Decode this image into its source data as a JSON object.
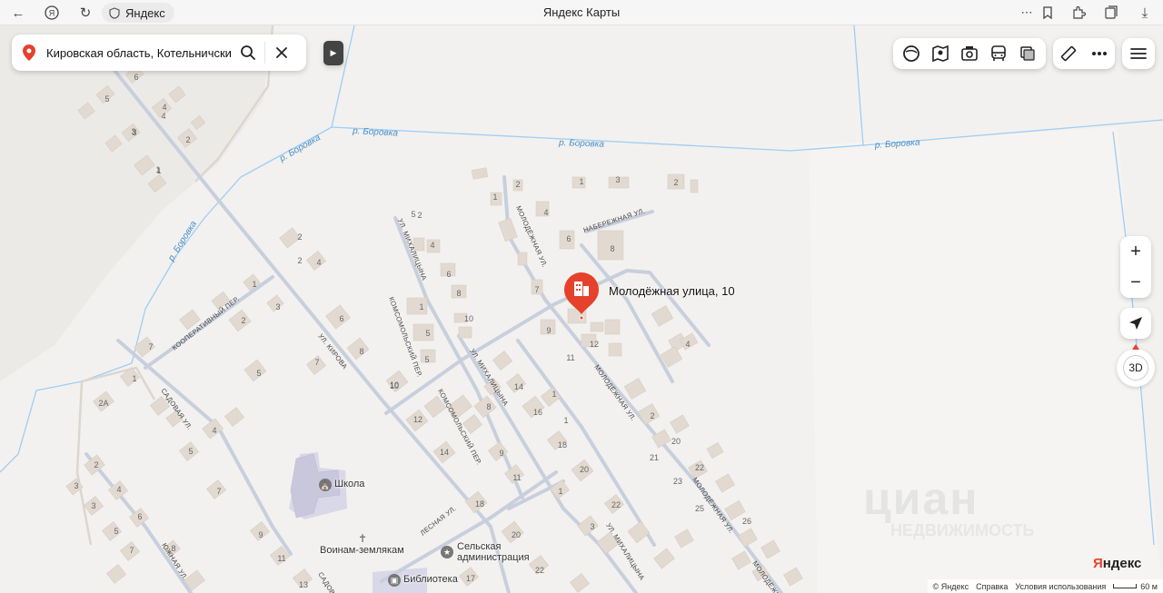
{
  "browser": {
    "site_name": "Яндекс",
    "page_title": "Яндекс Карты"
  },
  "search": {
    "value": "Кировская область, Котельничский р"
  },
  "place": {
    "label": "Молодёжная улица, 10"
  },
  "map_labels": {
    "rivers": [
      "р. Боровка",
      "р. Боровка",
      "р. Боровка",
      "р. Боровка",
      "р. Боровка"
    ],
    "streets": {
      "naberezhnaya": "НАБЕРЕЖНАЯ УЛ.",
      "molodezhnaya_1": "МОЛОДЁЖНАЯ УЛ.",
      "molodezhnaya_2": "МОЛОДЁЖНАЯ УЛ.",
      "molodezhnaya_3": "МОЛОДЁЖНАЯ УЛ.",
      "molodezhnaya_4": "МОЛОДЁЖНАЯ",
      "mikhalitsyna_1": "УЛ. МИХАЛИЦЫНА",
      "mikhalitsyna_2": "УЛ. МИХАЛИЦЫНА",
      "mikhalitsyna_3": "УЛ. МИХАЛИЦЫНА",
      "komsomolsky_1": "КОМСОМОЛЬСКИЙ ПЕР.",
      "komsomolsky_2": "КОМСОМОЛЬСКИЙ ПЕР.",
      "kooperativny": "КООПЕРАТИВНЫЙ ПЕР.",
      "kirova": "УЛ. КИРОВА",
      "sadovaya_1": "САДОВАЯ УЛ.",
      "sadovaya_2": "САДОВ",
      "lesnaya": "ЛЕСНАЯ УЛ.",
      "yuzhnaya": "ЮЖНАЯ УЛ."
    },
    "pois": {
      "school": "Школа",
      "memorial": "Воинам-землякам",
      "administration_1": "Сельская",
      "administration_2": "администрация",
      "library": "Библиотека"
    }
  },
  "house_numbers": [
    "6",
    "5",
    "4",
    "3",
    "2",
    "1",
    "2",
    "1",
    "4",
    "3",
    "2",
    "1",
    "4",
    "5",
    "6",
    "8",
    "2",
    "4",
    "6",
    "8",
    "7",
    "9",
    "10",
    "1",
    "3",
    "5",
    "8",
    "12",
    "14",
    "16",
    "18",
    "20",
    "22",
    "11",
    "10",
    "12",
    "14",
    "9",
    "11",
    "18",
    "20",
    "1",
    "3",
    "5",
    "17",
    "22",
    "21",
    "20",
    "23",
    "25",
    "26",
    "2A",
    "1",
    "7",
    "2",
    "1",
    "3",
    "7",
    "2",
    "4",
    "5",
    "6",
    "7",
    "3",
    "4",
    "5",
    "1",
    "5",
    "6",
    "8",
    "9",
    "11",
    "13",
    "10",
    "7",
    "8",
    "4",
    "2",
    "1",
    "1",
    "2",
    "4",
    "2",
    "3",
    "22"
  ],
  "controls": {
    "zoom_in": "+",
    "zoom_out": "−",
    "three_d": "3D"
  },
  "brand": "Яндекс",
  "footer": {
    "copyright": "© Яндекс",
    "help": "Справка",
    "terms": "Условия использования",
    "scale": "60 м"
  },
  "watermark": {
    "main": "циан",
    "sub": "НЕДВИЖИМОСТЬ"
  },
  "colors": {
    "map_bg": "#f2f1ef",
    "road": "#c8cfdc",
    "river": "#9ecdf3",
    "building": "#e2dad1",
    "pin": "#e5412b"
  }
}
